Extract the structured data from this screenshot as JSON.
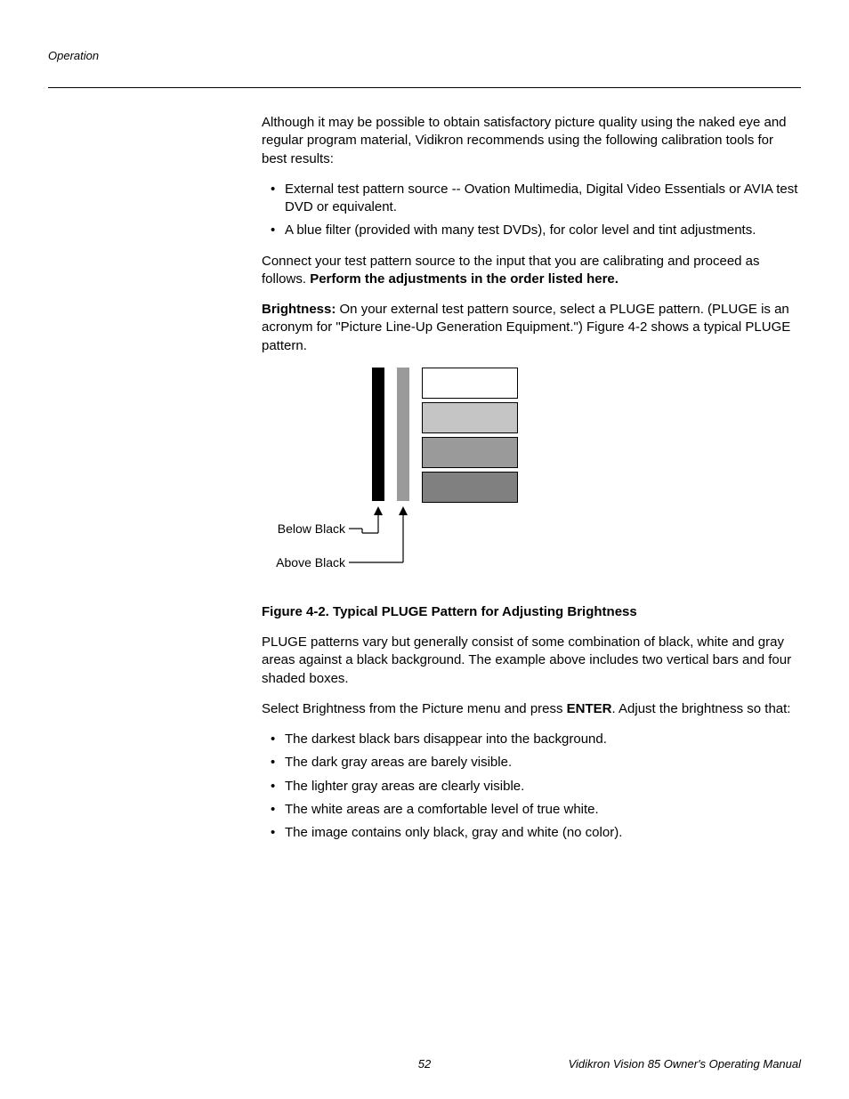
{
  "header": {
    "section": "Operation"
  },
  "body": {
    "intro": "Although it may be possible to obtain satisfactory picture quality using the naked eye and regular program material, Vidikron recommends using the following calibration tools for best results:",
    "tools": [
      "External test pattern source -- Ovation Multimedia, Digital Video Essentials or AVIA test DVD or equivalent.",
      "A blue filter (provided with many test DVDs), for color level and tint adjustments."
    ],
    "connect": "Connect your test pattern source to the input that you are calibrating and proceed as follows. ",
    "connect_bold": "Perform the adjustments in the order listed here.",
    "brightness_label": "Brightness: ",
    "brightness_text": "On your external test pattern source, select a PLUGE pattern. (PLUGE is an acronym for \"Picture Line-Up Generation Equipment.\") Figure 4-2 shows a typical PLUGE pattern.",
    "fig_labels": {
      "below": "Below Black",
      "above": "Above Black"
    },
    "fig_caption": "Figure 4-2. Typical PLUGE Pattern for Adjusting Brightness",
    "pluge_desc": "PLUGE patterns vary but generally consist of some combination of black, white and gray areas against a black background. The example above includes two vertical bars and four shaded boxes.",
    "select_pre": "Select Brightness from the Picture menu and press ",
    "select_bold": "ENTER",
    "select_post": ". Adjust the brightness so that:",
    "adjust_items": [
      "The darkest black bars disappear into the background.",
      "The dark gray areas are barely visible.",
      "The lighter gray areas are clearly visible.",
      "The white areas are a comfortable level of true white.",
      "The image contains only black, gray and white (no color)."
    ]
  },
  "footer": {
    "page": "52",
    "title": "Vidikron Vision 85 Owner's Operating Manual"
  }
}
